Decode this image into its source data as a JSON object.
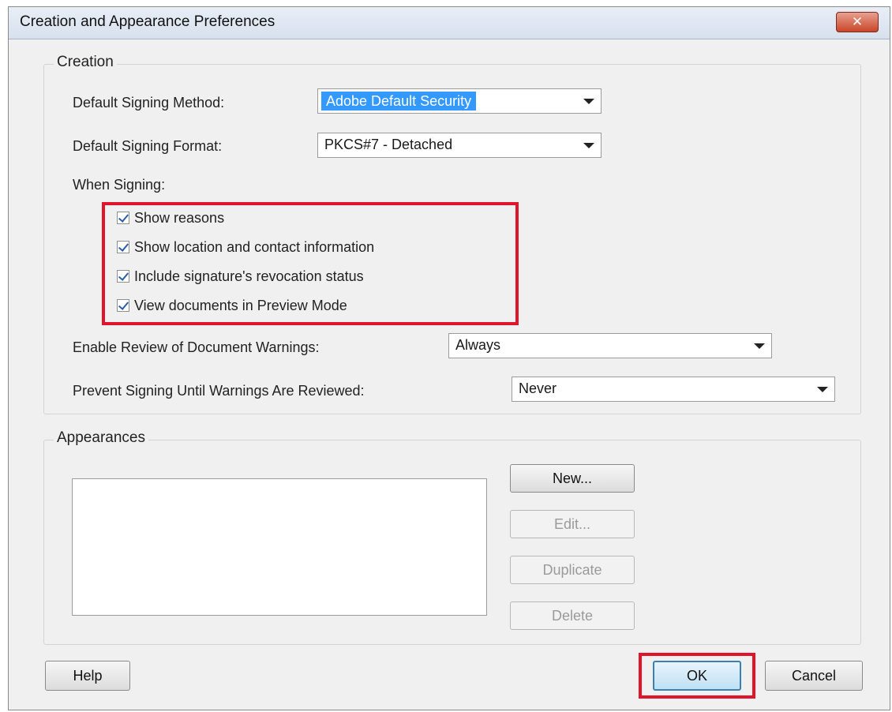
{
  "dialog": {
    "title": "Creation and Appearance Preferences",
    "close_glyph": "✕"
  },
  "creation": {
    "group_label": "Creation",
    "signing_method_label": "Default Signing Method:",
    "signing_method_value": "Adobe Default Security",
    "signing_format_label": "Default Signing Format:",
    "signing_format_value": "PKCS#7 - Detached",
    "when_signing_label": "When Signing:",
    "options": [
      {
        "label": "Show reasons",
        "checked": true
      },
      {
        "label": "Show location and contact information",
        "checked": true
      },
      {
        "label": "Include signature's revocation status",
        "checked": true
      },
      {
        "label": "View documents in Preview Mode",
        "checked": true
      }
    ],
    "review_warnings_label": "Enable Review of Document Warnings:",
    "review_warnings_value": "Always",
    "prevent_signing_label": "Prevent Signing Until Warnings Are Reviewed:",
    "prevent_signing_value": "Never"
  },
  "appearances": {
    "group_label": "Appearances",
    "new_label": "New...",
    "edit_label": "Edit...",
    "duplicate_label": "Duplicate",
    "delete_label": "Delete"
  },
  "footer": {
    "help_label": "Help",
    "ok_label": "OK",
    "cancel_label": "Cancel"
  },
  "colors": {
    "highlight": "#e0142a",
    "selection": "#3399ff"
  }
}
